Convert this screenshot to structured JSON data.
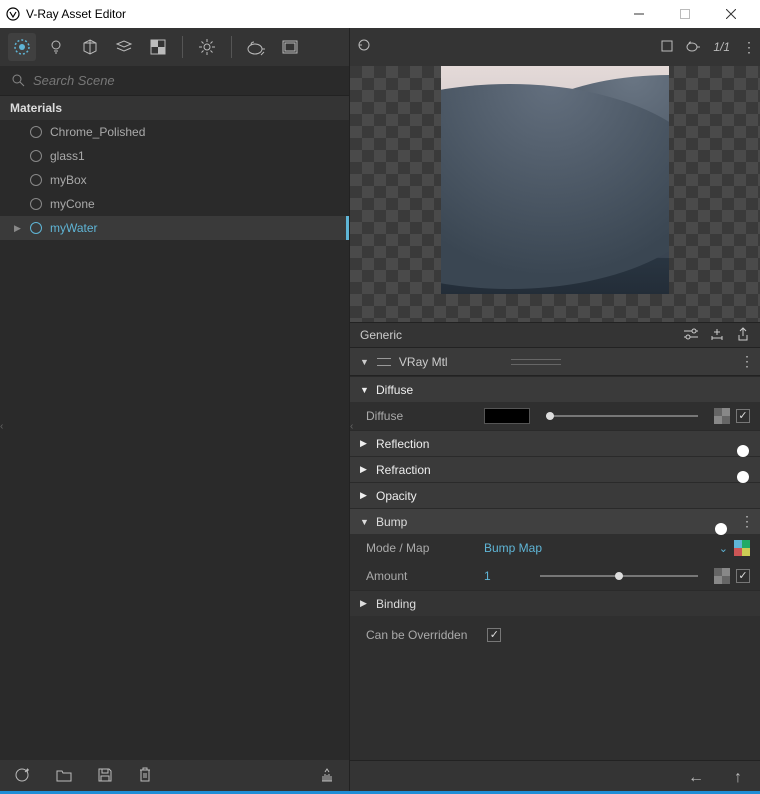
{
  "window": {
    "title": "V-Ray Asset Editor"
  },
  "left": {
    "search_placeholder": "Search Scene",
    "materials_header": "Materials",
    "materials": [
      {
        "name": "Chrome_Polished",
        "selected": false
      },
      {
        "name": "glass1",
        "selected": false
      },
      {
        "name": "myBox",
        "selected": false
      },
      {
        "name": "myCone",
        "selected": false
      },
      {
        "name": "myWater",
        "selected": true
      }
    ]
  },
  "right": {
    "preview_ratio": "1/1",
    "section_title": "Generic",
    "material_type": "VRay Mtl",
    "groups": {
      "diffuse": {
        "label": "Diffuse",
        "param_label": "Diffuse"
      },
      "reflection": {
        "label": "Reflection"
      },
      "refraction": {
        "label": "Refraction"
      },
      "opacity": {
        "label": "Opacity"
      },
      "bump": {
        "label": "Bump",
        "mode_label": "Mode / Map",
        "mode_value": "Bump Map",
        "amount_label": "Amount",
        "amount_value": "1"
      },
      "binding": {
        "label": "Binding"
      }
    },
    "overridden_label": "Can be Overridden"
  },
  "toolbar_icons": {
    "materials": "materials-icon",
    "lights": "light-icon",
    "geometry": "cube-icon",
    "layers": "layers-icon",
    "textures": "checker-icon",
    "settings": "gear-icon",
    "render": "teapot-icon",
    "frame": "frame-icon"
  }
}
